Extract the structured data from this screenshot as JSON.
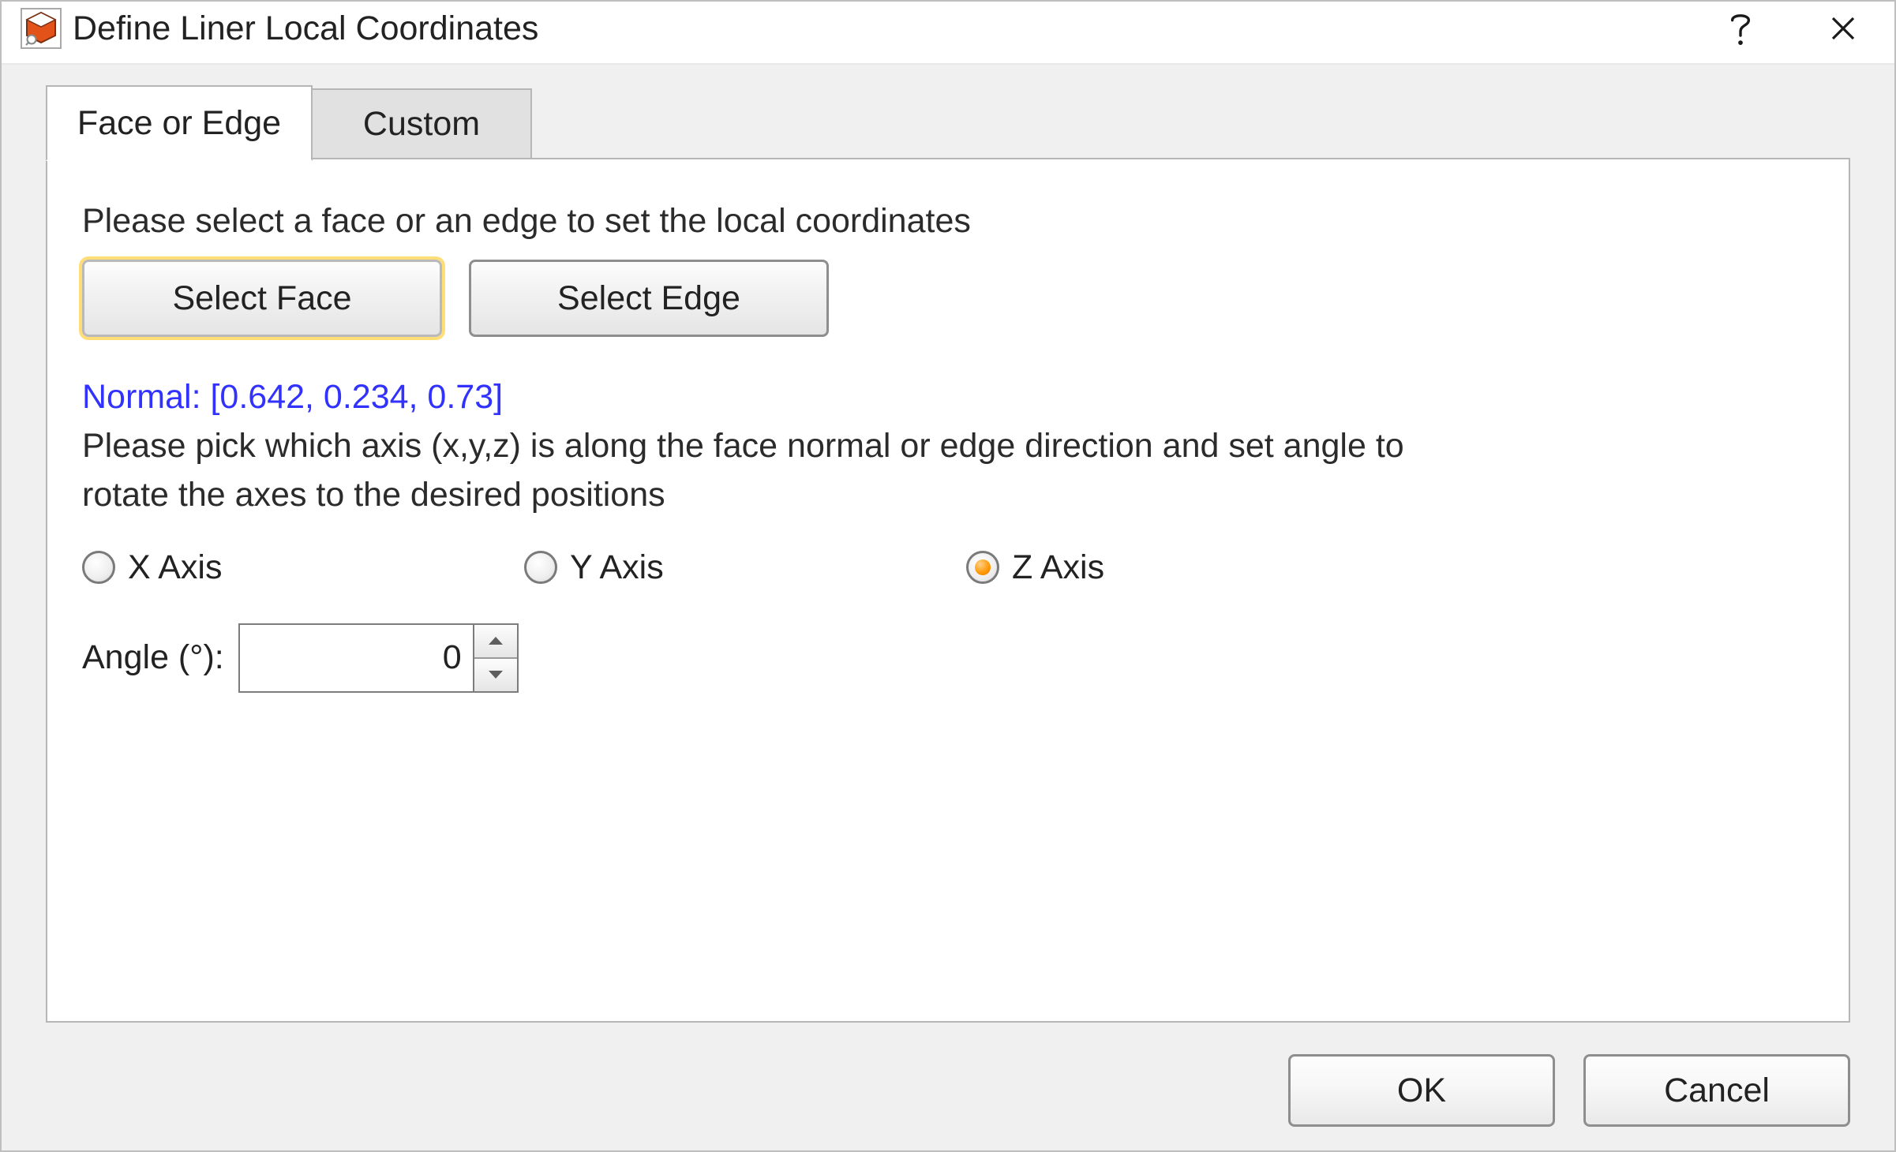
{
  "title": "Define Liner Local Coordinates",
  "tabs": {
    "face_or_edge": "Face or Edge",
    "custom": "Custom"
  },
  "content": {
    "instruction1": "Please select a face or an edge to set the local coordinates",
    "select_face": "Select Face",
    "select_edge": "Select Edge",
    "normal": "Normal: [0.642, 0.234, 0.73]",
    "instruction2": "Please pick which axis (x,y,z) is along the face normal or edge direction and set angle to rotate the axes to the desired positions",
    "axes": {
      "x": "X Axis",
      "y": "Y Axis",
      "z": "Z Axis",
      "selected": "z"
    },
    "angle_label": "Angle (°):",
    "angle_value": "0"
  },
  "buttons": {
    "ok": "OK",
    "cancel": "Cancel"
  }
}
